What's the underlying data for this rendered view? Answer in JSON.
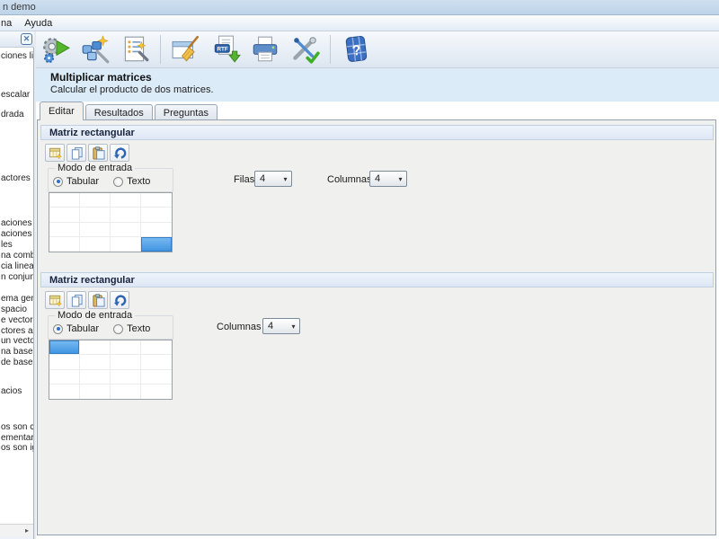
{
  "window": {
    "title_fragment": "n demo"
  },
  "menubar": {
    "items": [
      {
        "label": "na"
      },
      {
        "label": "Ayuda"
      }
    ]
  },
  "main_toolbar": {
    "buttons": [
      {
        "name": "run",
        "icon": "gears-play-icon"
      },
      {
        "name": "wizard",
        "icon": "puzzle-wand-icon"
      },
      {
        "name": "review-steps",
        "icon": "list-search-icon"
      },
      {
        "name": "clear",
        "icon": "window-broom-icon"
      },
      {
        "name": "export-rtf",
        "icon": "rtf-download-icon",
        "badge": "RTF"
      },
      {
        "name": "print",
        "icon": "printer-icon"
      },
      {
        "name": "settings",
        "icon": "tools-check-icon"
      },
      {
        "name": "help",
        "icon": "help-icon",
        "glyph": "?"
      }
    ]
  },
  "sidebar": {
    "close_glyph": "✕",
    "scroll_arrow": "▸",
    "items": [
      "ciones line",
      "escalar",
      "drada",
      "actores",
      "aciones lin",
      "aciones lin",
      "les",
      "na combina",
      "cia lineal",
      "n conjunto",
      "ema gene",
      "spacio",
      "e vectores",
      "ctores a u",
      "un vector",
      "na base",
      "de base",
      "acios",
      "os son co",
      "ementario",
      "os son igu"
    ]
  },
  "header": {
    "title": "Multiplicar matrices",
    "subtitle": "Calcular el producto de dos matrices."
  },
  "tabs": [
    {
      "label": "Editar",
      "active": true
    },
    {
      "label": "Resultados",
      "active": false
    },
    {
      "label": "Preguntas",
      "active": false
    }
  ],
  "sections": [
    {
      "title": "Matriz rectangular",
      "input_mode": {
        "label": "Modo de entrada",
        "options": [
          {
            "label": "Tabular",
            "selected": true
          },
          {
            "label": "Texto",
            "selected": false
          }
        ]
      },
      "dims": [
        {
          "label": "Filas",
          "value": "4"
        },
        {
          "label": "Columnas",
          "value": "4"
        }
      ],
      "grid": {
        "rows": 4,
        "cols": 4,
        "selected_row": 3,
        "selected_col": 3
      }
    },
    {
      "title": "Matriz rectangular",
      "input_mode": {
        "label": "Modo de entrada",
        "options": [
          {
            "label": "Tabular",
            "selected": true
          },
          {
            "label": "Texto",
            "selected": false
          }
        ]
      },
      "dims": [
        {
          "label": "Columnas",
          "value": "4"
        }
      ],
      "grid": {
        "rows": 4,
        "cols": 4,
        "selected_row": 0,
        "selected_col": 0
      }
    }
  ],
  "colors": {
    "selected_cell": "#4d9ce6",
    "accent": "#3a6fc4",
    "header_bg": "#dcebf8",
    "section_header_bg": "#e4ecf7"
  }
}
